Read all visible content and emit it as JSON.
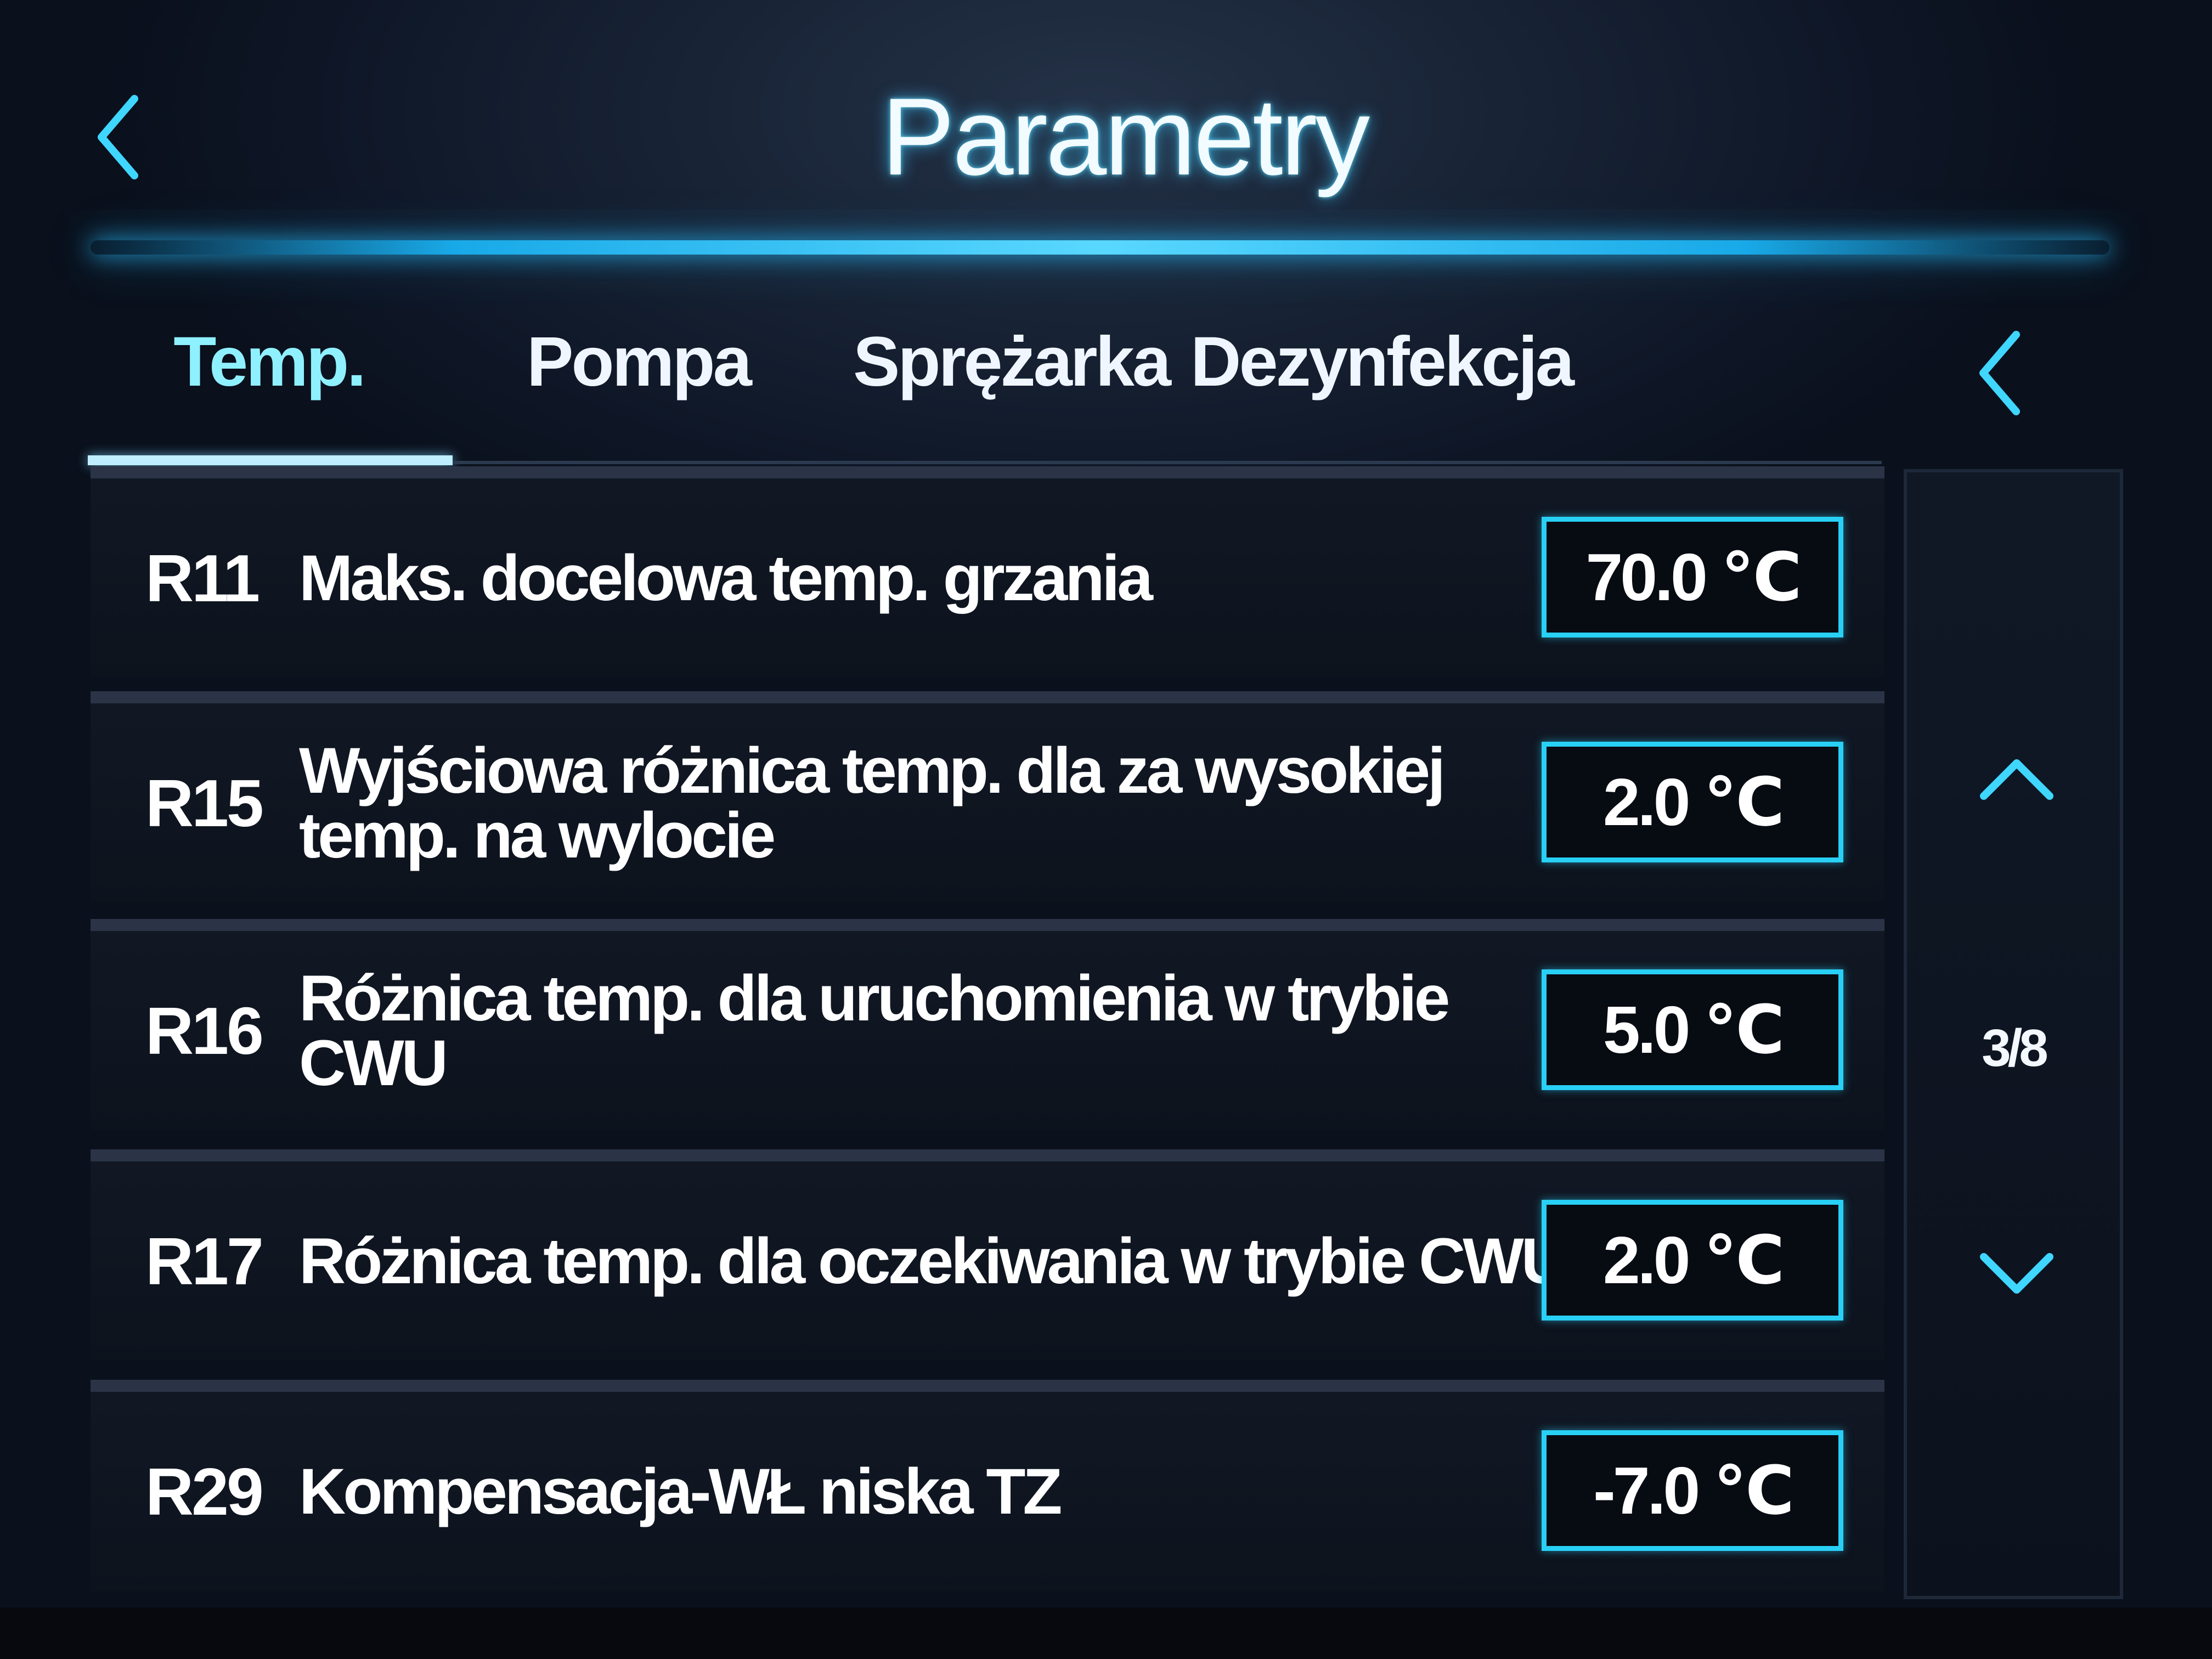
{
  "header": {
    "title": "Parametry",
    "back_icon": "chevron-left-icon"
  },
  "tabs": [
    {
      "label": "Temp.",
      "active": true
    },
    {
      "label": "Pompa",
      "active": false
    },
    {
      "label": "Sprężarka",
      "active": false
    },
    {
      "label": "Dezynfekcja",
      "active": false
    }
  ],
  "tabs_prev_icon": "chevron-left-icon",
  "rows": [
    {
      "code": "R11",
      "label": "Maks. docelowa temp. grzania",
      "value": "70.0 ℃"
    },
    {
      "code": "R15",
      "label": "Wyjściowa różnica temp. dla za wysokiej temp. na wylocie",
      "value": "2.0 ℃"
    },
    {
      "code": "R16",
      "label": "Różnica temp. dla uruchomienia w trybie CWU",
      "value": "5.0 ℃"
    },
    {
      "code": "R17",
      "label": "Różnica temp. dla oczekiwania w trybie CWU",
      "value": "2.0 ℃"
    },
    {
      "code": "R29",
      "label": "Kompensacja-WŁ niska TZ",
      "value": "-7.0 ℃"
    }
  ],
  "pagination": {
    "page": "3/8",
    "up_icon": "chevron-up-icon",
    "down_icon": "chevron-down-icon"
  },
  "colors": {
    "accent": "#28d0f5",
    "title_glow": "#3cc8ff",
    "background": "#0e1626"
  }
}
